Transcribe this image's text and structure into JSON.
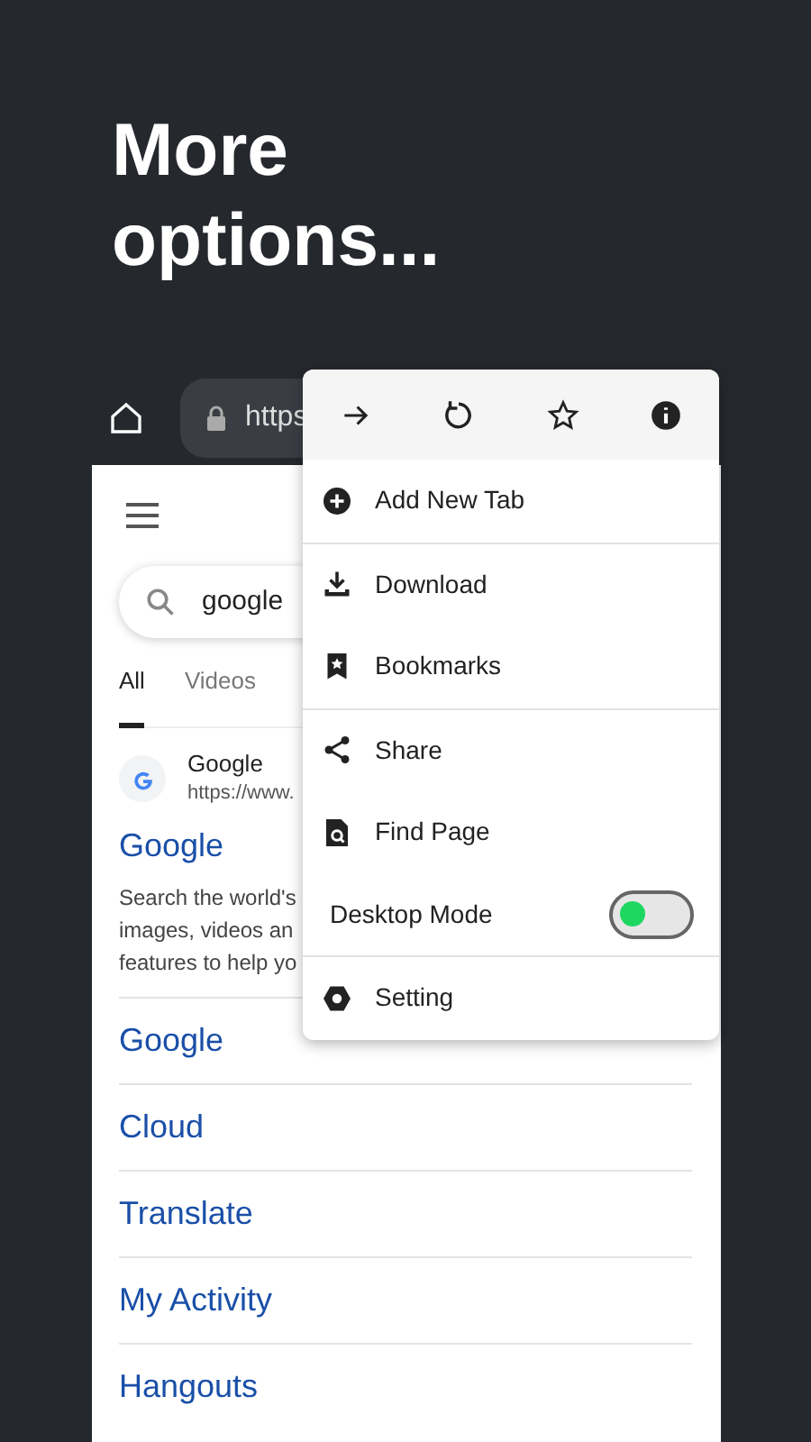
{
  "headline": [
    "More",
    "options..."
  ],
  "toolbar": {
    "url": "https"
  },
  "page": {
    "search": {
      "value": "google"
    },
    "tabs": [
      {
        "label": "All",
        "selected": true
      },
      {
        "label": "Videos",
        "selected": false
      }
    ],
    "result": {
      "site": "Google",
      "address": "https://www.",
      "title": "Google",
      "snippet": [
        "Search the world's",
        "images, videos an",
        "features to help yo"
      ]
    },
    "links": [
      "Google",
      "Cloud",
      "Translate",
      "My Activity",
      "Hangouts"
    ]
  },
  "menu": {
    "actions": [
      {
        "kind": "forward"
      },
      {
        "kind": "reload"
      },
      {
        "kind": "star"
      },
      {
        "kind": "info"
      }
    ],
    "groups": [
      [
        {
          "kind": "add",
          "label": "Add New Tab"
        }
      ],
      [
        {
          "kind": "download",
          "label": "Download"
        },
        {
          "kind": "bookmark",
          "label": "Bookmarks"
        }
      ],
      [
        {
          "kind": "share",
          "label": "Share"
        },
        {
          "kind": "find",
          "label": "Find Page"
        },
        {
          "kind": "toggle",
          "label": "Desktop Mode",
          "on": false
        }
      ],
      [
        {
          "kind": "setting",
          "label": "Setting"
        }
      ]
    ]
  }
}
